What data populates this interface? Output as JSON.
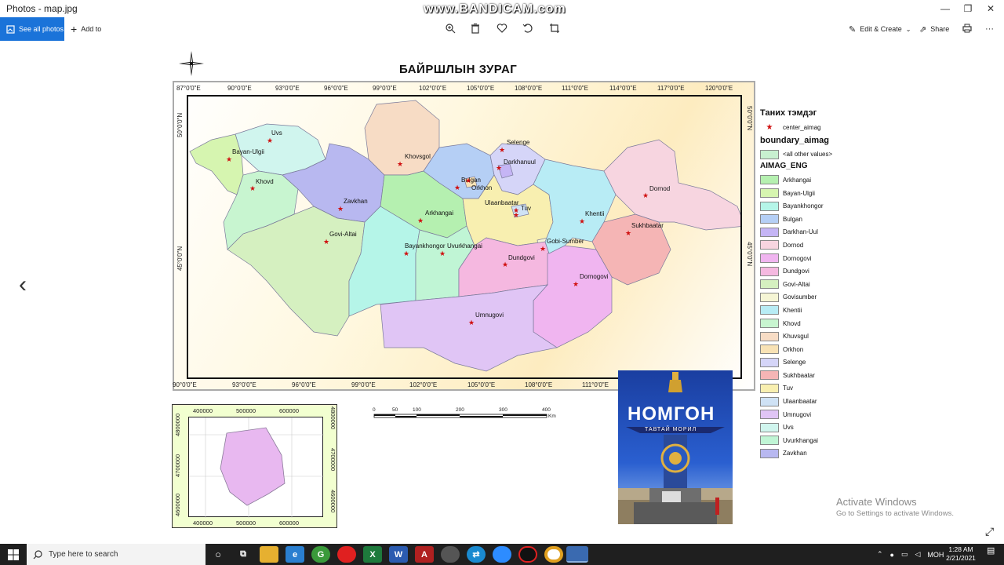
{
  "window": {
    "title": "Photos - map.jpg",
    "watermark": "www.BANDICAM.com",
    "minimize": "—",
    "maximize": "❐",
    "close": "✕"
  },
  "toolbar": {
    "see_all_photos": "See all photos",
    "add_to": "Add to",
    "edit_create": "Edit & Create",
    "share": "Share",
    "more": "···",
    "icons": [
      "zoom-icon",
      "delete-icon",
      "favorite-icon",
      "rotate-icon",
      "crop-icon",
      "print-icon"
    ]
  },
  "map": {
    "title": "БАЙРШЛЫН ЗУРАГ",
    "top_degrees": [
      "87°0'0\"E",
      "90°0'0\"E",
      "93°0'0\"E",
      "96°0'0\"E",
      "99°0'0\"E",
      "102°0'0\"E",
      "105°0'0\"E",
      "108°0'0\"E",
      "111°0'0\"E",
      "114°0'0\"E",
      "117°0'0\"E",
      "120°0'0\"E"
    ],
    "bottom_degrees": [
      "90°0'0\"E",
      "93°0'0\"E",
      "96°0'0\"E",
      "99°0'0\"E",
      "102°0'0\"E",
      "105°0'0\"E",
      "108°0'0\"E",
      "111°0'0\"E"
    ],
    "lat_50": "50°0'0\"N",
    "lat_45": "45°0'0\"N",
    "aimag_labels": [
      {
        "name": "Uvs"
      },
      {
        "name": "Bayan-Ulgii"
      },
      {
        "name": "Khovd"
      },
      {
        "name": "Zavkhan"
      },
      {
        "name": "Govi-Altai"
      },
      {
        "name": "Khovsgol"
      },
      {
        "name": "Arkhangai"
      },
      {
        "name": "Bayankhongor"
      },
      {
        "name": "Uvurkhangai"
      },
      {
        "name": "Bulgan"
      },
      {
        "name": "Orkhon"
      },
      {
        "name": "Selenge"
      },
      {
        "name": "Darkhanuul"
      },
      {
        "name": "Ulaanbaatar"
      },
      {
        "name": "Tuv"
      },
      {
        "name": "Gobi-Sumber"
      },
      {
        "name": "Dundgovi"
      },
      {
        "name": "Dornogovi"
      },
      {
        "name": "Umnugovi"
      },
      {
        "name": "Khentii"
      },
      {
        "name": "Dornod"
      },
      {
        "name": "Sukhbaatar"
      }
    ]
  },
  "legend": {
    "heading": "Таних тэмдэг",
    "center_label": "center_aimag",
    "boundary_heading": "boundary_aimag",
    "all_other": "<all other values>",
    "aimag_heading": "AIMAG_ENG",
    "items": [
      {
        "label": "Arkhangai",
        "color": "#b5f0b0"
      },
      {
        "label": "Bayan-Ulgii",
        "color": "#d6f5b0"
      },
      {
        "label": "Bayankhongor",
        "color": "#b5f5e8"
      },
      {
        "label": "Bulgan",
        "color": "#b5cff5"
      },
      {
        "label": "Darkhan-Uul",
        "color": "#c5b5f5"
      },
      {
        "label": "Dornod",
        "color": "#f7d5e0"
      },
      {
        "label": "Dornogovi",
        "color": "#f0b5f0"
      },
      {
        "label": "Dundgovi",
        "color": "#f5b8e0"
      },
      {
        "label": "Govi-Altai",
        "color": "#d5f0c0"
      },
      {
        "label": "Govisumber",
        "color": "#f5f5d5"
      },
      {
        "label": "Khentii",
        "color": "#b8ecf5"
      },
      {
        "label": "Khovd",
        "color": "#c8f5d0"
      },
      {
        "label": "Khuvsgul",
        "color": "#f7dcc5"
      },
      {
        "label": "Orkhon",
        "color": "#f8e2b5"
      },
      {
        "label": "Selenge",
        "color": "#d5d5f8"
      },
      {
        "label": "Sukhbaatar",
        "color": "#f5b5b5"
      },
      {
        "label": "Tuv",
        "color": "#f8efb0"
      },
      {
        "label": "Ulaanbaatar",
        "color": "#cfe2f5"
      },
      {
        "label": "Umnugovi",
        "color": "#e0c5f5"
      },
      {
        "label": "Uvs",
        "color": "#d0f5ee"
      },
      {
        "label": "Uvurkhangai",
        "color": "#c0f5d5"
      },
      {
        "label": "Zavkhan",
        "color": "#b8b8f0"
      }
    ]
  },
  "inset": {
    "top_ticks": [
      "400000",
      "500000",
      "600000"
    ],
    "bottom_ticks": [
      "400000",
      "500000",
      "600000"
    ],
    "side_ticks": [
      "4800000",
      "4700000",
      "4600000"
    ]
  },
  "scale": {
    "ticks": [
      "0",
      "50",
      "100",
      "200",
      "300",
      "400"
    ],
    "unit": "Km"
  },
  "photo": {
    "title": "НОМГОН",
    "subtitle": "ТАВТАЙ МОРИЛ"
  },
  "activation": {
    "line1": "Activate Windows",
    "line2": "Go to Settings to activate Windows."
  },
  "taskbar": {
    "search_placeholder": "Type here to search",
    "lang": "МОН",
    "time": "1:28 AM",
    "date": "2/21/2021"
  }
}
